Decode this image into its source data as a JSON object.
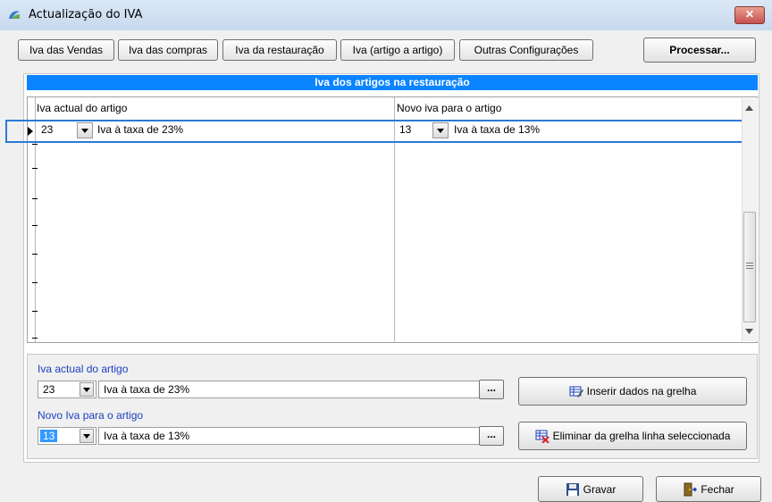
{
  "window": {
    "title": "Actualização do IVA",
    "close_glyph": "✕"
  },
  "toolbar": {
    "tabs": [
      "Iva das Vendas",
      "Iva das compras",
      "Iva da restauração",
      "Iva (artigo a artigo)",
      "Outras Configurações"
    ],
    "process_label": "Processar..."
  },
  "section": {
    "title": "Iva dos artigos na restauração"
  },
  "grid": {
    "col1_header": "Iva actual do artigo",
    "col2_header": "Novo iva para o artigo",
    "rows": [
      {
        "current_code": "23",
        "current_desc": "Iva à taxa de 23%",
        "new_code": "13",
        "new_desc": "Iva à taxa de 13%"
      }
    ]
  },
  "form": {
    "current_label": "Iva actual do artigo",
    "current_code": "23",
    "current_desc": "Iva à taxa de 23%",
    "new_label": "Novo Iva para o artigo",
    "new_code": "13",
    "new_desc": "Iva à taxa de 13%",
    "ellipsis": "...",
    "insert_label": "Inserir dados na grelha",
    "delete_label": "Eliminar da grelha linha seleccionada"
  },
  "footer": {
    "save_label": "Gravar",
    "close_label": "Fechar"
  },
  "icons": {
    "app": "app-logo-icon",
    "insert": "insert-grid-icon",
    "delete": "delete-grid-icon",
    "save": "floppy-disk-icon",
    "exit": "exit-door-icon"
  },
  "colors": {
    "section_header": "#0a84ff",
    "blue_label": "#1a3fbf",
    "selection": "#3399ff"
  }
}
